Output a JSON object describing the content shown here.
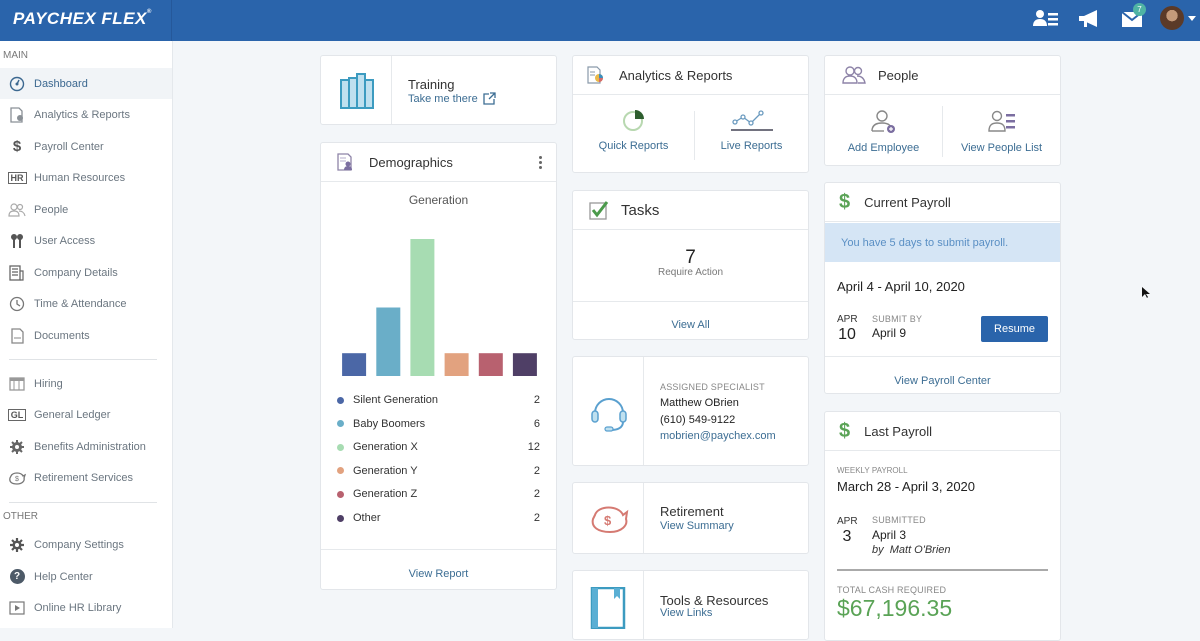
{
  "app": {
    "logo": "PAYCHEX FLEX",
    "logo_mark": "®"
  },
  "topbar": {
    "icons": [
      "people-list-icon",
      "megaphone-icon",
      "messages-icon",
      "avatar"
    ],
    "messages_badge": "7"
  },
  "sidebar": {
    "main_label": "MAIN",
    "other_label": "OTHER",
    "items": [
      {
        "label": "Dashboard",
        "icon": "dashboard-icon",
        "active": true
      },
      {
        "label": "Analytics & Reports",
        "icon": "analytics-icon"
      },
      {
        "label": "Payroll Center",
        "icon": "dollar-icon"
      },
      {
        "label": "Human Resources",
        "icon": "hr-icon"
      },
      {
        "label": "People",
        "icon": "people-icon"
      },
      {
        "label": "User Access",
        "icon": "keys-icon"
      },
      {
        "label": "Company Details",
        "icon": "building-icon"
      },
      {
        "label": "Time & Attendance",
        "icon": "clock-icon"
      },
      {
        "label": "Documents",
        "icon": "document-icon"
      },
      {
        "label": "Hiring",
        "icon": "hiring-icon"
      },
      {
        "label": "General Ledger",
        "icon": "gl-icon"
      },
      {
        "label": "Benefits Administration",
        "icon": "benefits-icon"
      },
      {
        "label": "Retirement Services",
        "icon": "piggy-bank-icon"
      }
    ],
    "other_items": [
      {
        "label": "Company Settings",
        "icon": "gear-icon"
      },
      {
        "label": "Help Center",
        "icon": "help-icon"
      },
      {
        "label": "Online HR Library",
        "icon": "library-icon"
      }
    ]
  },
  "training": {
    "title": "Training",
    "link": "Take me there"
  },
  "demographics": {
    "title": "Demographics",
    "view_report": "View Report"
  },
  "chart_data": {
    "type": "bar",
    "title": "Generation",
    "categories": [
      "Silent Generation",
      "Baby Boomers",
      "Generation X",
      "Generation Y",
      "Generation Z",
      "Other"
    ],
    "values": [
      2,
      6,
      12,
      2,
      2,
      2
    ],
    "colors": [
      "#4b67a6",
      "#6aaec8",
      "#a7dcb2",
      "#e2a27f",
      "#b8616f",
      "#4f3f66"
    ],
    "xlabel": "",
    "ylabel": "",
    "ylim": [
      0,
      12
    ],
    "grid": false,
    "legend": "below"
  },
  "analytics": {
    "title": "Analytics & Reports",
    "quick": "Quick Reports",
    "live": "Live Reports"
  },
  "tasks": {
    "title": "Tasks",
    "count": "7",
    "caption": "Require Action",
    "view_all": "View All"
  },
  "specialist": {
    "caption": "ASSIGNED SPECIALIST",
    "name": "Matthew OBrien",
    "phone": "(610) 549-9122",
    "email": "mobrien@paychex.com"
  },
  "retirement": {
    "title": "Retirement",
    "link": "View Summary"
  },
  "tools": {
    "title": "Tools & Resources",
    "link": "View Links"
  },
  "people": {
    "title": "People",
    "add": "Add Employee",
    "list": "View People List"
  },
  "current_payroll": {
    "title": "Current Payroll",
    "alert": "You have 5 days to submit payroll.",
    "period": "April 4 - April 10, 2020",
    "month": "APR",
    "day": "10",
    "submit_caption": "SUBMIT BY",
    "submit_date": "April 9",
    "resume": "Resume",
    "view_center": "View Payroll Center"
  },
  "last_payroll": {
    "title": "Last Payroll",
    "type": "WEEKLY PAYROLL",
    "period": "March 28 - April 3, 2020",
    "month": "APR",
    "day": "3",
    "status_caption": "SUBMITTED",
    "status_date": "April 3",
    "by": "by  Matt O'Brien",
    "total_caption": "TOTAL CASH REQUIRED",
    "total": "$67,196.35"
  },
  "colors": {
    "brand": "#2a64ab",
    "link": "#3c6d93",
    "money_green": "#5aa356",
    "alert_bg": "#d5e5f5"
  }
}
